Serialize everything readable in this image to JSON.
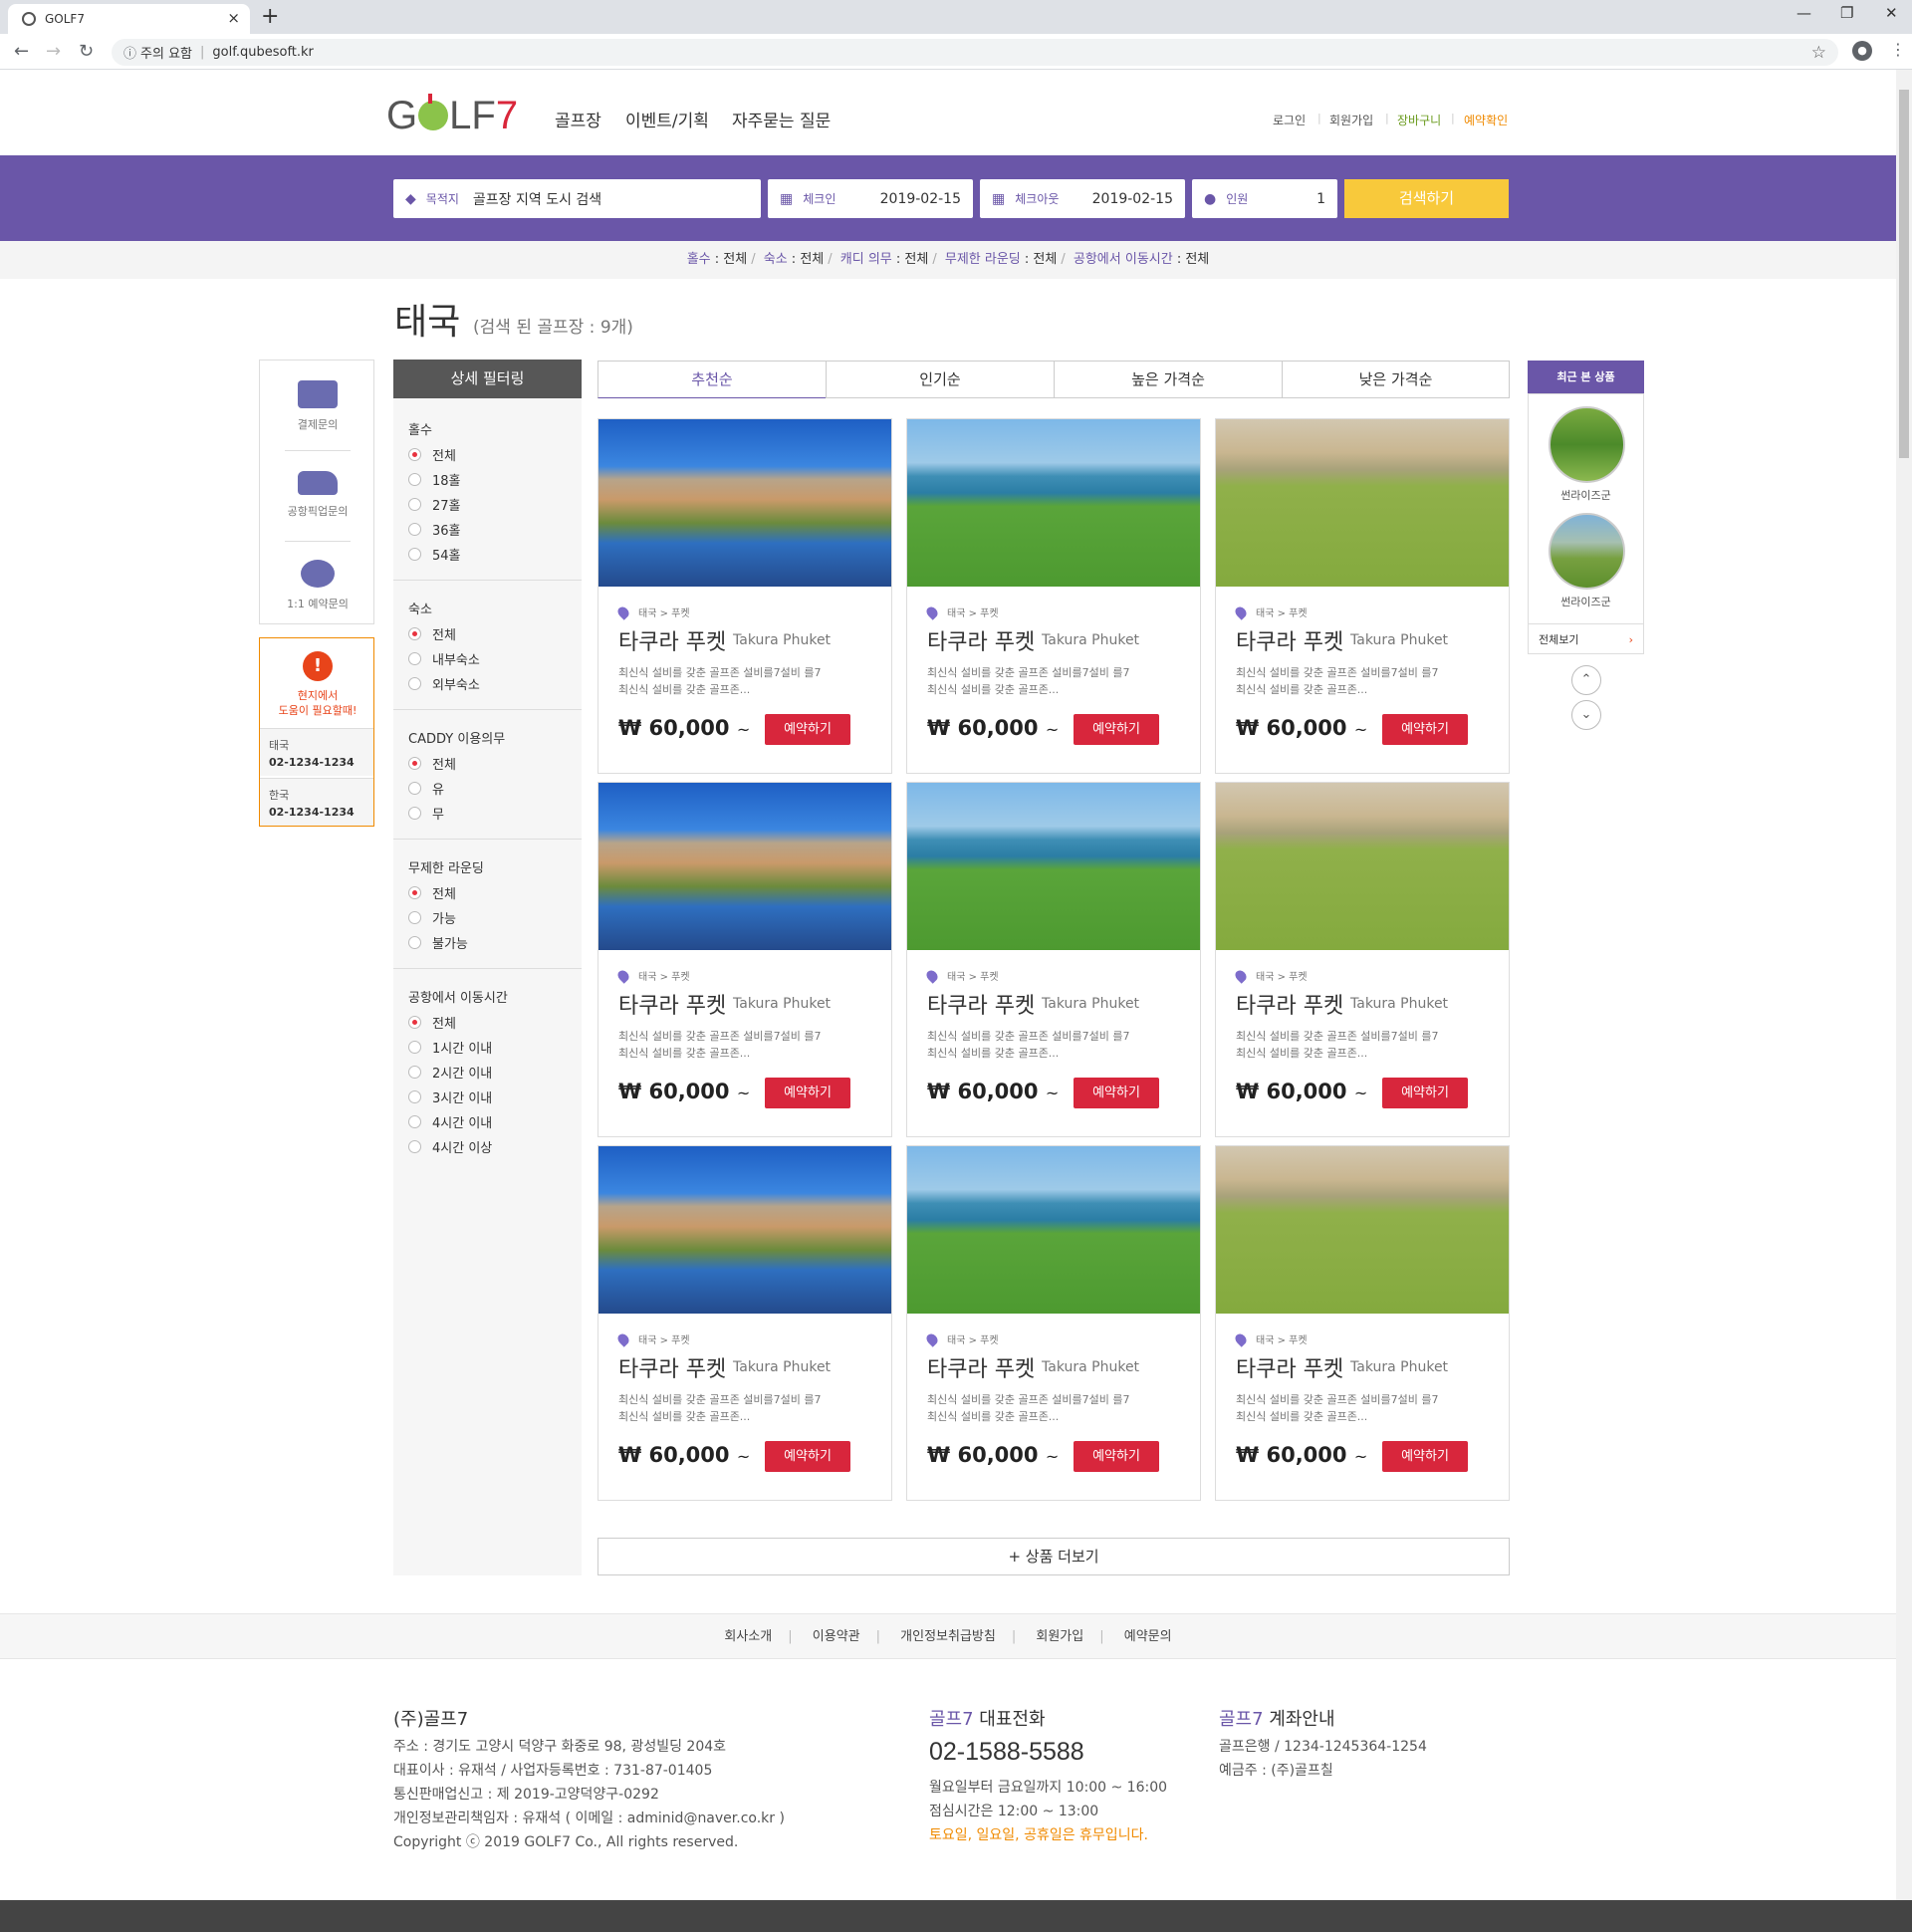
{
  "browser": {
    "tab_title": "GOLF7",
    "new_tab": "+",
    "close_tab": "×",
    "minimize": "—",
    "restore": "❐",
    "close_window": "✕",
    "security": "주의 요함",
    "url": "golf.qubesoft.kr"
  },
  "header": {
    "logo": {
      "g": "G",
      "rest": "LF",
      "seven": "7"
    },
    "nav": [
      "골프장",
      "이벤트/기획",
      "자주묻는 질문"
    ],
    "util": [
      "로그인",
      "회원가입",
      "장바구니",
      "예약확인"
    ]
  },
  "search": {
    "destination_label": "목적지",
    "destination_value": "골프장 지역 도시 검색",
    "checkin_label": "체크인",
    "checkin_value": "2019-02-15",
    "checkout_label": "체크아웃",
    "checkout_value": "2019-02-15",
    "people_label": "인원",
    "people_value": "1",
    "button": "검색하기"
  },
  "summary": [
    {
      "k": "홀수",
      "v": " : 전체"
    },
    {
      "k": "숙소",
      "v": " : 전체"
    },
    {
      "k": "캐디 의무",
      "v": " : 전체"
    },
    {
      "k": "무제한 라운딩",
      "v": " : 전체"
    },
    {
      "k": "공항에서 이동시간",
      "v": " : 전체"
    }
  ],
  "page": {
    "title": "태국",
    "count": "(검색 된 골프장 : 9개)"
  },
  "quick": [
    {
      "label": "결제문의",
      "icon": "card-icon"
    },
    {
      "label": "공항픽업문의",
      "icon": "van-icon"
    },
    {
      "label": "1:1 예약문의",
      "icon": "chat-icon"
    }
  ],
  "help": {
    "mark": "!",
    "line1": "현지에서",
    "line2": "도움이 필요할때!",
    "rows": [
      {
        "country": "태국",
        "phone": "02-1234-1234"
      },
      {
        "country": "한국",
        "phone": "02-1234-1234"
      }
    ]
  },
  "filters": {
    "title": "상세 필터링",
    "groups": [
      {
        "title": "홀수",
        "options": [
          "전체",
          "18홀",
          "27홀",
          "36홀",
          "54홀"
        ]
      },
      {
        "title": "숙소",
        "options": [
          "전체",
          "내부숙소",
          "외부숙소"
        ]
      },
      {
        "title": "CADDY 이용의무",
        "options": [
          "전체",
          "유",
          "무"
        ]
      },
      {
        "title": "무제한 라운딩",
        "options": [
          "전체",
          "가능",
          "불가능"
        ]
      },
      {
        "title": "공항에서 이동시간",
        "options": [
          "전체",
          "1시간 이내",
          "2시간 이내",
          "3시간 이내",
          "4시간 이내",
          "4시간 이상"
        ]
      }
    ]
  },
  "sort": [
    "추천순",
    "인기순",
    "높은 가격순",
    "낮은 가격순"
  ],
  "products": [
    {
      "location": "태국 > 푸켓",
      "name": "타쿠라 푸켓",
      "name_en": "Takura Phuket",
      "desc1": "최신식 설비를 갖춘 골프존 설비를7설비 를7",
      "desc2": "최신식 설비를 갖춘 골프존...",
      "price": "₩ 60,000",
      "tilde": "~",
      "button": "예약하기",
      "image": "desert-course"
    },
    {
      "location": "태국 > 푸켓",
      "name": "타쿠라 푸켓",
      "name_en": "Takura Phuket",
      "desc1": "최신식 설비를 갖춘 골프존 설비를7설비 를7",
      "desc2": "최신식 설비를 갖춘 골프존...",
      "price": "₩ 60,000",
      "tilde": "~",
      "button": "예약하기",
      "image": "seaside-range"
    },
    {
      "location": "태국 > 푸켓",
      "name": "타쿠라 푸켓",
      "name_en": "Takura Phuket",
      "desc1": "최신식 설비를 갖춘 골프존 설비를7설비 를7",
      "desc2": "최신식 설비를 갖춘 골프존...",
      "price": "₩ 60,000",
      "tilde": "~",
      "button": "예약하기",
      "image": "golfer-swing"
    },
    {
      "location": "태국 > 푸켓",
      "name": "타쿠라 푸켓",
      "name_en": "Takura Phuket",
      "desc1": "최신식 설비를 갖춘 골프존 설비를7설비 를7",
      "desc2": "최신식 설비를 갖춘 골프존...",
      "price": "₩ 60,000",
      "tilde": "~",
      "button": "예약하기",
      "image": "desert-course"
    },
    {
      "location": "태국 > 푸켓",
      "name": "타쿠라 푸켓",
      "name_en": "Takura Phuket",
      "desc1": "최신식 설비를 갖춘 골프존 설비를7설비 를7",
      "desc2": "최신식 설비를 갖춘 골프존...",
      "price": "₩ 60,000",
      "tilde": "~",
      "button": "예약하기",
      "image": "seaside-range"
    },
    {
      "location": "태국 > 푸켓",
      "name": "타쿠라 푸켓",
      "name_en": "Takura Phuket",
      "desc1": "최신식 설비를 갖춘 골프존 설비를7설비 를7",
      "desc2": "최신식 설비를 갖춘 골프존...",
      "price": "₩ 60,000",
      "tilde": "~",
      "button": "예약하기",
      "image": "golfer-swing"
    },
    {
      "location": "태국 > 푸켓",
      "name": "타쿠라 푸켓",
      "name_en": "Takura Phuket",
      "desc1": "최신식 설비를 갖춘 골프존 설비를7설비 를7",
      "desc2": "최신식 설비를 갖춘 골프존...",
      "price": "₩ 60,000",
      "tilde": "~",
      "button": "예약하기",
      "image": "desert-course"
    },
    {
      "location": "태국 > 푸켓",
      "name": "타쿠라 푸켓",
      "name_en": "Takura Phuket",
      "desc1": "최신식 설비를 갖춘 골프존 설비를7설비 를7",
      "desc2": "최신식 설비를 갖춘 골프존...",
      "price": "₩ 60,000",
      "tilde": "~",
      "button": "예약하기",
      "image": "seaside-range"
    },
    {
      "location": "태국 > 푸켓",
      "name": "타쿠라 푸켓",
      "name_en": "Takura Phuket",
      "desc1": "최신식 설비를 갖춘 골프존 설비를7설비 를7",
      "desc2": "최신식 설비를 갖춘 골프존...",
      "price": "₩ 60,000",
      "tilde": "~",
      "button": "예약하기",
      "image": "golfer-swing"
    }
  ],
  "more_button": "+ 상품 더보기",
  "recent": {
    "title": "최근 본 상품",
    "items": [
      "썬라이즈군",
      "썬라이즈군"
    ],
    "view_all": "전체보기",
    "view_all_arrow": "›",
    "up": "⌃",
    "down": "⌄"
  },
  "footer": {
    "nav": [
      "회사소개",
      "이용약관",
      "개인정보취급방침",
      "회원가입",
      "예약문의"
    ],
    "company": {
      "title": "(주)골프7",
      "lines": [
        "주소 : 경기도 고양시 덕양구 화중로 98, 광성빌딩 204호",
        "대표이사 : 유재석  /  사업자등록번호 : 731-87-01405",
        "통신판매업신고 : 제 2019-고양덕양구-0292",
        "개인정보관리책임자 : 유재석 ( 이메일 : adminid@naver.co.kr )",
        "Copyright ⓒ 2019 GOLF7 Co., All rights reserved."
      ]
    },
    "phone": {
      "title_brand": "골프7",
      "title_rest": " 대표전화",
      "number": "02-1588-5588",
      "hours1": "월요일부터 금요일까지 10:00 ~ 16:00",
      "hours2": "점심시간은 12:00 ~ 13:00",
      "holiday": "토요일, 일요일, 공휴일은 휴무입니다."
    },
    "bank": {
      "title_brand": "골프7",
      "title_rest": " 계좌안내",
      "line1": "골프은행  /  1234-1245364-1254",
      "line2": "예금주 : (주)골프칠"
    }
  },
  "colors": {
    "brand_purple": "#6a56a8",
    "cta_yellow": "#f8c93b",
    "book_red": "#d8263c",
    "accent_orange": "#f08a00"
  }
}
